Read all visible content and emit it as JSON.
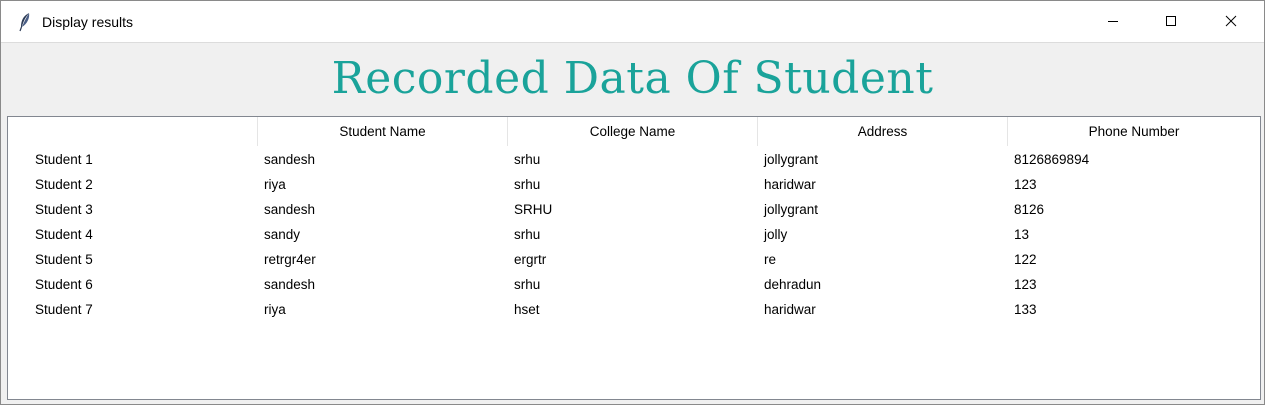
{
  "window": {
    "title": "Display results"
  },
  "banner": {
    "title": "Recorded Data Of Student",
    "color": "#1aa39a"
  },
  "table": {
    "headers": [
      "",
      "Student Name",
      "College Name",
      "Address",
      "Phone Number"
    ],
    "rows": [
      [
        "Student 1",
        "sandesh",
        "srhu",
        "jollygrant",
        "8126869894"
      ],
      [
        "Student 2",
        "riya",
        "srhu",
        "haridwar",
        "123"
      ],
      [
        "Student 3",
        "sandesh",
        "SRHU",
        "jollygrant",
        "8126"
      ],
      [
        "Student 4",
        "sandy",
        "srhu",
        "jolly",
        "13"
      ],
      [
        "Student 5",
        "retrgr4er",
        "ergrtr",
        "re",
        "122"
      ],
      [
        "Student 6",
        "sandesh",
        "srhu",
        "dehradun",
        "123"
      ],
      [
        "Student 7",
        "riya",
        "hset",
        "haridwar",
        "133"
      ]
    ]
  },
  "icons": {
    "app": "feather-icon",
    "minimize": "minimize-icon",
    "maximize": "maximize-icon",
    "close": "close-icon"
  }
}
